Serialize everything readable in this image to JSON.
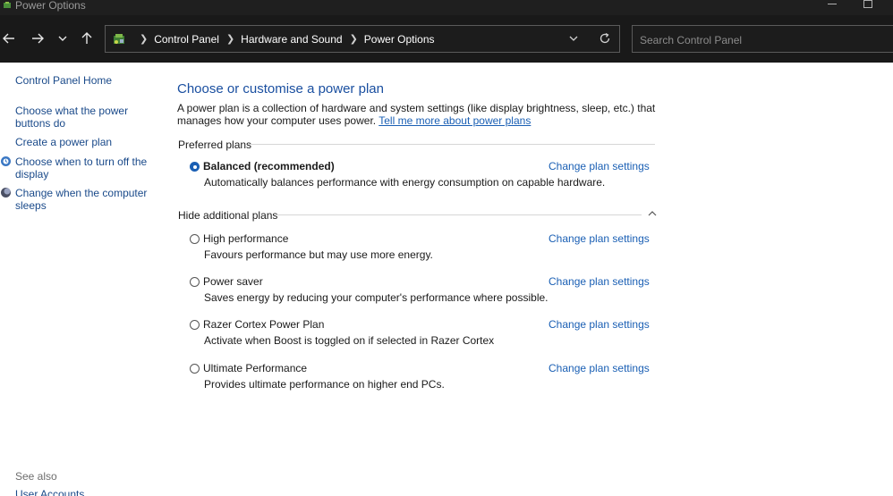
{
  "window": {
    "title": "Power Options"
  },
  "nav": {
    "breadcrumb": [
      "Control Panel",
      "Hardware and Sound",
      "Power Options"
    ],
    "search_placeholder": "Search Control Panel"
  },
  "left": {
    "links": [
      "Control Panel Home",
      "Choose what the power buttons do",
      "Create a power plan",
      "Choose when to turn off the display",
      "Change when the computer sleeps"
    ],
    "see_also": "See also",
    "user_accounts": "User Accounts"
  },
  "main": {
    "title": "Choose or customise a power plan",
    "intro": "A power plan is a collection of hardware and system settings (like display brightness, sleep, etc.) that manages how your computer uses power. ",
    "intro_link": "Tell me more about power plans",
    "preferred_heading": "Preferred plans",
    "additional_heading": "Hide additional plans",
    "change_settings_label": "Change plan settings",
    "preferred_plans": [
      {
        "name": "Balanced (recommended)",
        "description": "Automatically balances performance with energy consumption on capable hardware.",
        "selected": true
      }
    ],
    "additional_plans": [
      {
        "name": "High performance",
        "description": "Favours performance but may use more energy.",
        "selected": false
      },
      {
        "name": "Power saver",
        "description": "Saves energy by reducing your computer's performance where possible.",
        "selected": false
      },
      {
        "name": "Razer Cortex Power Plan",
        "description": "Activate when Boost is toggled on if selected in Razer Cortex",
        "selected": false
      },
      {
        "name": "Ultimate Performance",
        "description": "Provides ultimate performance on higher end PCs.",
        "selected": false
      }
    ]
  },
  "colors": {
    "accent": "#1a5fb4",
    "titlebar": "#1f1f1f",
    "navbar": "#191919"
  }
}
